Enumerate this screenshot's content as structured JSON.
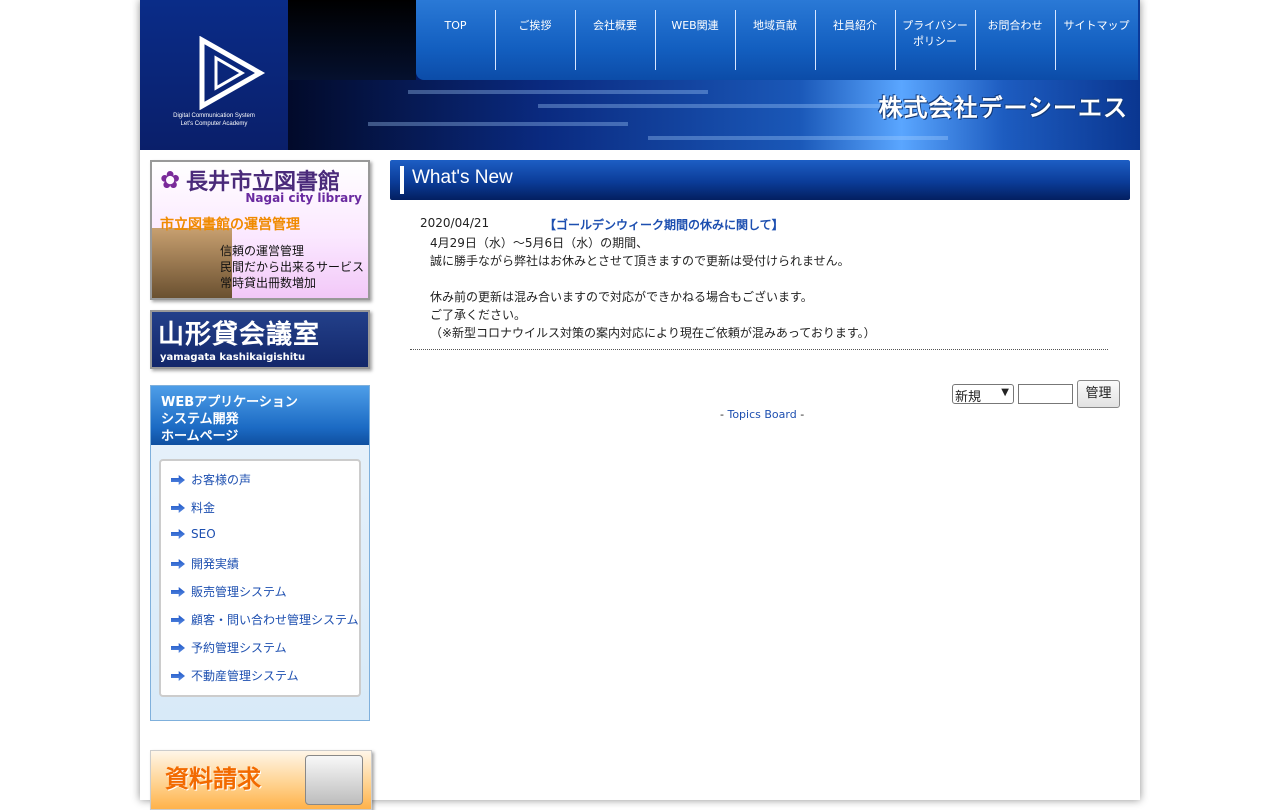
{
  "header": {
    "company_name": "株式会社デーシーエス",
    "logo_line1": "Digital Communication System",
    "logo_line2": "Let's Computer Academy",
    "nav": [
      {
        "label": "TOP"
      },
      {
        "label": "ご挨拶"
      },
      {
        "label": "会社概要"
      },
      {
        "label": "WEB関連"
      },
      {
        "label": "地域貢献"
      },
      {
        "label": "社員紹介"
      },
      {
        "label": "プライバシーポリシー"
      },
      {
        "label": "お問合わせ"
      },
      {
        "label": "サイトマップ"
      }
    ]
  },
  "sidebar": {
    "library_banner": {
      "title": "長井市立図書館",
      "subtitle": "Nagai city library",
      "heading": "市立図書館の運営管理",
      "lines": [
        "信頼の運営管理",
        "民間だから出来るサービス",
        "常時貸出冊数増加"
      ]
    },
    "yamagata_banner": {
      "title": "山形貸会議室",
      "subtitle": "yamagata kashikaigishitu"
    },
    "web_box": {
      "head_lines": [
        "WEBアプリケーション",
        "システム開発",
        "ホームページ"
      ],
      "items": [
        {
          "label": "お客様の声"
        },
        {
          "label": "料金"
        },
        {
          "label": "SEO"
        },
        {
          "label": "開発実績"
        },
        {
          "label": "販売管理システム"
        },
        {
          "label": "顧客・問い合わせ管理システム"
        },
        {
          "label": "予約管理システム"
        },
        {
          "label": "不動産管理システム"
        }
      ]
    },
    "doc_banner": {
      "title": "資料請求"
    }
  },
  "main": {
    "whats_new_title": "What's New",
    "news": {
      "date": "2020/04/21",
      "title": "【ゴールデンウィーク期間の休みに関して】",
      "body": [
        "4月29日（水）～5月6日（水）の期間、",
        "誠に勝手ながら弊社はお休みとさせて頂きますので更新は受付けられません。",
        "",
        "休み前の更新は混み合いますので対応ができかねる場合もございます。",
        "ご了承ください。",
        "（※新型コロナウイルス対策の案内対応により現在ご依頼が混みあっております。）"
      ]
    },
    "admin": {
      "mode_selected": "新規",
      "password_value": "",
      "button_label": "管理"
    },
    "topics": {
      "prefix": "- ",
      "link": "Topics Board",
      "suffix": " -"
    }
  },
  "colors": {
    "link": "#1d4fb0",
    "header_dark": "#031f60",
    "accent_orange": "#f26a00"
  }
}
